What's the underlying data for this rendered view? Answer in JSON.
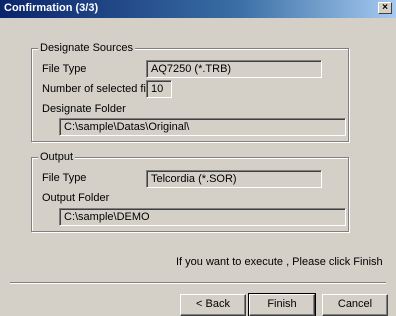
{
  "window": {
    "title": "Confirmation (3/3)",
    "close_glyph": "×"
  },
  "sources": {
    "legend": "Designate Sources",
    "file_type_label": "File Type",
    "file_type_value": "AQ7250 (*.TRB)",
    "count_label": "Number of selected files",
    "count_value": "10",
    "folder_label": "Designate Folder",
    "folder_value": "C:\\sample\\Datas\\Original\\"
  },
  "output": {
    "legend": "Output",
    "file_type_label": "File Type",
    "file_type_value": "Telcordia (*.SOR)",
    "folder_label": "Output Folder",
    "folder_value": "C:\\sample\\DEMO"
  },
  "message": "If you want to execute , Please click Finish",
  "buttons": {
    "back": "< Back",
    "finish": "Finish",
    "cancel": "Cancel"
  },
  "colors": {
    "dialog_bg": "#d4d0c8",
    "title_bar": "#0a246a"
  },
  "icons": {
    "close": "close-icon"
  }
}
